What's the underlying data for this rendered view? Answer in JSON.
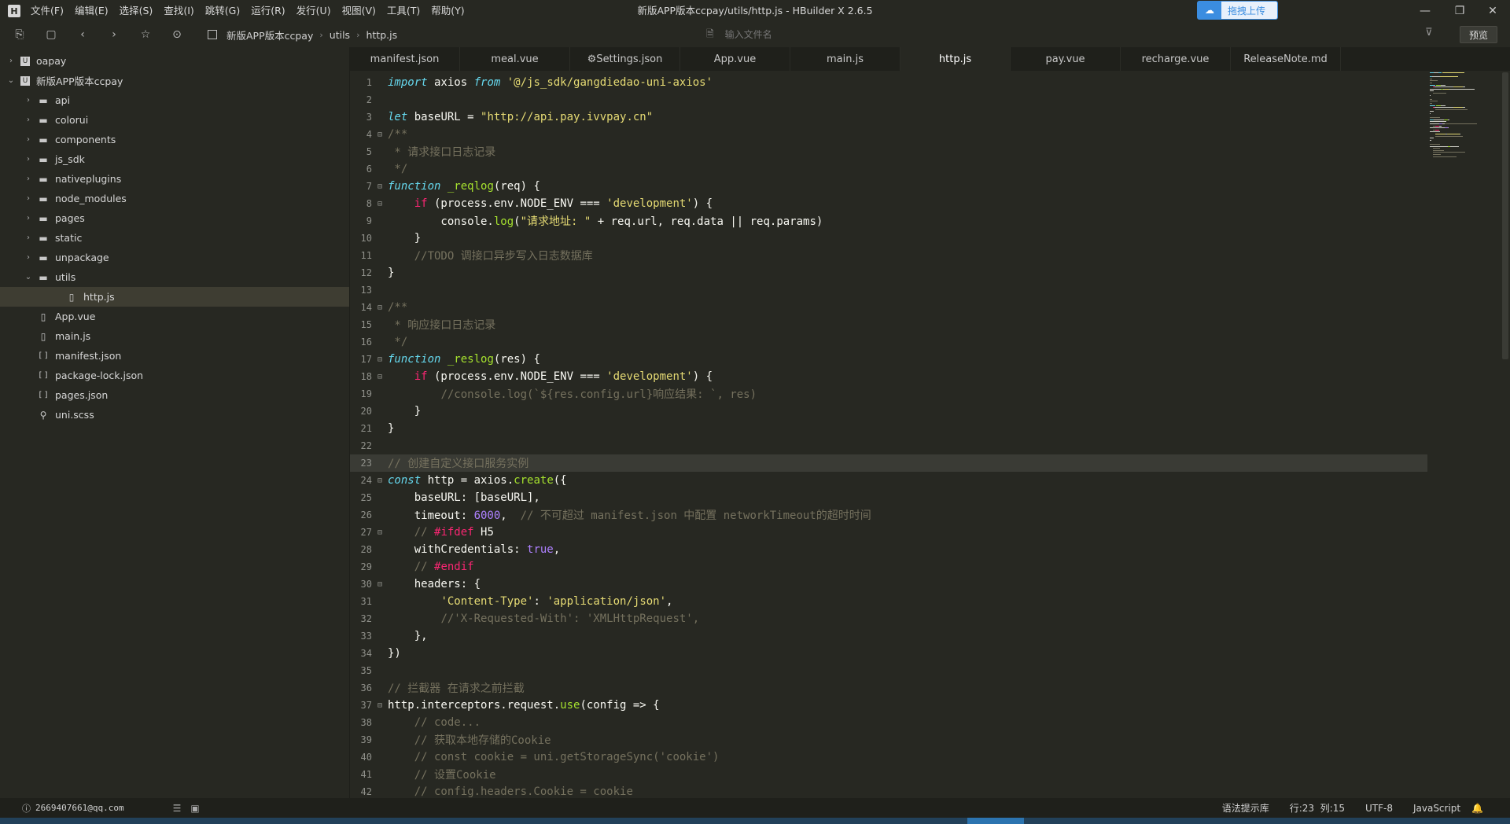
{
  "window": {
    "title": "新版APP版本ccpay/utils/http.js - HBuilder X 2.6.5",
    "upload_label": "拖拽上传"
  },
  "menu": [
    "文件(F)",
    "编辑(E)",
    "选择(S)",
    "查找(I)",
    "跳转(G)",
    "运行(R)",
    "发行(U)",
    "视图(V)",
    "工具(T)",
    "帮助(Y)"
  ],
  "toolbar": {
    "breadcrumb": [
      "新版APP版本ccpay",
      "utils",
      "http.js"
    ],
    "file_search_placeholder": "输入文件名",
    "preview_label": "预览"
  },
  "sidebar": {
    "items": [
      {
        "label": "oapay",
        "depth": 0,
        "kind": "project",
        "expanded": false
      },
      {
        "label": "新版APP版本ccpay",
        "depth": 0,
        "kind": "project",
        "expanded": true
      },
      {
        "label": "api",
        "depth": 1,
        "kind": "folder",
        "expanded": false
      },
      {
        "label": "colorui",
        "depth": 1,
        "kind": "folder",
        "expanded": false
      },
      {
        "label": "components",
        "depth": 1,
        "kind": "folder",
        "expanded": false
      },
      {
        "label": "js_sdk",
        "depth": 1,
        "kind": "folder",
        "expanded": false
      },
      {
        "label": "nativeplugins",
        "depth": 1,
        "kind": "folder",
        "expanded": false
      },
      {
        "label": "node_modules",
        "depth": 1,
        "kind": "folder",
        "expanded": false
      },
      {
        "label": "pages",
        "depth": 1,
        "kind": "folder",
        "expanded": false
      },
      {
        "label": "static",
        "depth": 1,
        "kind": "folder",
        "expanded": false
      },
      {
        "label": "unpackage",
        "depth": 1,
        "kind": "folder",
        "expanded": false
      },
      {
        "label": "utils",
        "depth": 1,
        "kind": "folder",
        "expanded": true
      },
      {
        "label": "http.js",
        "depth": 2,
        "kind": "file",
        "selected": true
      },
      {
        "label": "App.vue",
        "depth": 1,
        "kind": "vue"
      },
      {
        "label": "main.js",
        "depth": 1,
        "kind": "file"
      },
      {
        "label": "manifest.json",
        "depth": 1,
        "kind": "json"
      },
      {
        "label": "package-lock.json",
        "depth": 1,
        "kind": "json"
      },
      {
        "label": "pages.json",
        "depth": 1,
        "kind": "json"
      },
      {
        "label": "uni.scss",
        "depth": 1,
        "kind": "scss"
      }
    ]
  },
  "tabs": [
    {
      "label": "manifest.json"
    },
    {
      "label": "meal.vue"
    },
    {
      "label": "⚙Settings.json"
    },
    {
      "label": "App.vue"
    },
    {
      "label": "main.js"
    },
    {
      "label": "http.js",
      "active": true
    },
    {
      "label": "pay.vue"
    },
    {
      "label": "recharge.vue"
    },
    {
      "label": "ReleaseNote.md"
    }
  ],
  "code_lines": [
    {
      "n": "1",
      "fold": "",
      "tokens": [
        [
          "kw",
          "import"
        ],
        [
          "t",
          " axios "
        ],
        [
          "kw",
          "from"
        ],
        [
          "t",
          " "
        ],
        [
          "str",
          "'@/js_sdk/gangdiedao-uni-axios'"
        ]
      ]
    },
    {
      "n": "2",
      "fold": "",
      "tokens": []
    },
    {
      "n": "3",
      "fold": "",
      "tokens": [
        [
          "kw",
          "let"
        ],
        [
          "t",
          " baseURL = "
        ],
        [
          "str",
          "\"http://api.pay.ivvpay.cn\""
        ]
      ]
    },
    {
      "n": "4",
      "fold": "⊟",
      "tokens": [
        [
          "cmt",
          "/**"
        ]
      ]
    },
    {
      "n": "5",
      "fold": "",
      "tokens": [
        [
          "cmt",
          " * 请求接口日志记录"
        ]
      ]
    },
    {
      "n": "6",
      "fold": "",
      "tokens": [
        [
          "cmt",
          " */"
        ]
      ]
    },
    {
      "n": "7",
      "fold": "⊟",
      "tokens": [
        [
          "kw",
          "function"
        ],
        [
          "t",
          " "
        ],
        [
          "fn",
          "_reqlog"
        ],
        [
          "t",
          "(req) {"
        ]
      ]
    },
    {
      "n": "8",
      "fold": "⊟",
      "tokens": [
        [
          "t",
          "    "
        ],
        [
          "kw2",
          "if"
        ],
        [
          "t",
          " (process.env.NODE_ENV === "
        ],
        [
          "str",
          "'development'"
        ],
        [
          "t",
          ") {"
        ]
      ]
    },
    {
      "n": "9",
      "fold": "",
      "tokens": [
        [
          "t",
          "        console."
        ],
        [
          "fn",
          "log"
        ],
        [
          "t",
          "("
        ],
        [
          "str",
          "\"请求地址: \""
        ],
        [
          "t",
          " + req.url, req.data || req.params)"
        ]
      ]
    },
    {
      "n": "10",
      "fold": "",
      "tokens": [
        [
          "t",
          "    }"
        ]
      ]
    },
    {
      "n": "11",
      "fold": "",
      "tokens": [
        [
          "t",
          "    "
        ],
        [
          "cmt",
          "//TODO 调接口异步写入日志数据库"
        ]
      ]
    },
    {
      "n": "12",
      "fold": "",
      "tokens": [
        [
          "t",
          "}"
        ]
      ]
    },
    {
      "n": "13",
      "fold": "",
      "tokens": []
    },
    {
      "n": "14",
      "fold": "⊟",
      "tokens": [
        [
          "cmt",
          "/**"
        ]
      ]
    },
    {
      "n": "15",
      "fold": "",
      "tokens": [
        [
          "cmt",
          " * 响应接口日志记录"
        ]
      ]
    },
    {
      "n": "16",
      "fold": "",
      "tokens": [
        [
          "cmt",
          " */"
        ]
      ]
    },
    {
      "n": "17",
      "fold": "⊟",
      "tokens": [
        [
          "kw",
          "function"
        ],
        [
          "t",
          " "
        ],
        [
          "fn",
          "_reslog"
        ],
        [
          "t",
          "(res) {"
        ]
      ]
    },
    {
      "n": "18",
      "fold": "⊟",
      "tokens": [
        [
          "t",
          "    "
        ],
        [
          "kw2",
          "if"
        ],
        [
          "t",
          " (process.env.NODE_ENV === "
        ],
        [
          "str",
          "'development'"
        ],
        [
          "t",
          ") {"
        ]
      ]
    },
    {
      "n": "19",
      "fold": "",
      "tokens": [
        [
          "t",
          "        "
        ],
        [
          "cmt",
          "//console.log(`${res.config.url}响应结果: `, res)"
        ]
      ]
    },
    {
      "n": "20",
      "fold": "",
      "tokens": [
        [
          "t",
          "    }"
        ]
      ]
    },
    {
      "n": "21",
      "fold": "",
      "tokens": [
        [
          "t",
          "}"
        ]
      ]
    },
    {
      "n": "22",
      "fold": "",
      "tokens": []
    },
    {
      "n": "23",
      "fold": "",
      "cur": true,
      "tokens": [
        [
          "cmt",
          "// 创建自定义接口服务实例"
        ]
      ]
    },
    {
      "n": "24",
      "fold": "⊟",
      "tokens": [
        [
          "kw",
          "const"
        ],
        [
          "t",
          " http = axios."
        ],
        [
          "fn",
          "create"
        ],
        [
          "t",
          "({"
        ]
      ]
    },
    {
      "n": "25",
      "fold": "",
      "tokens": [
        [
          "t",
          "    baseURL: [baseURL],"
        ]
      ]
    },
    {
      "n": "26",
      "fold": "",
      "tokens": [
        [
          "t",
          "    timeout: "
        ],
        [
          "num",
          "6000"
        ],
        [
          "t",
          ",  "
        ],
        [
          "cmt",
          "// 不可超过 manifest.json 中配置 networkTimeout的超时时间"
        ]
      ]
    },
    {
      "n": "27",
      "fold": "⊟",
      "tokens": [
        [
          "t",
          "    "
        ],
        [
          "cmt",
          "// "
        ],
        [
          "pp",
          "#ifdef"
        ],
        [
          "t",
          " H5"
        ]
      ]
    },
    {
      "n": "28",
      "fold": "",
      "tokens": [
        [
          "t",
          "    withCredentials: "
        ],
        [
          "num",
          "true"
        ],
        [
          "t",
          ","
        ]
      ]
    },
    {
      "n": "29",
      "fold": "",
      "tokens": [
        [
          "t",
          "    "
        ],
        [
          "cmt",
          "// "
        ],
        [
          "pp",
          "#endif"
        ]
      ]
    },
    {
      "n": "30",
      "fold": "⊟",
      "tokens": [
        [
          "t",
          "    headers: {"
        ]
      ]
    },
    {
      "n": "31",
      "fold": "",
      "tokens": [
        [
          "t",
          "        "
        ],
        [
          "str",
          "'Content-Type'"
        ],
        [
          "t",
          ": "
        ],
        [
          "str",
          "'application/json'"
        ],
        [
          "t",
          ","
        ]
      ]
    },
    {
      "n": "32",
      "fold": "",
      "tokens": [
        [
          "t",
          "        "
        ],
        [
          "cmt",
          "//'X-Requested-With': 'XMLHttpRequest',"
        ]
      ]
    },
    {
      "n": "33",
      "fold": "",
      "tokens": [
        [
          "t",
          "    },"
        ]
      ]
    },
    {
      "n": "34",
      "fold": "",
      "tokens": [
        [
          "t",
          "})"
        ]
      ]
    },
    {
      "n": "35",
      "fold": "",
      "tokens": []
    },
    {
      "n": "36",
      "fold": "",
      "tokens": [
        [
          "cmt",
          "// 拦截器 在请求之前拦截"
        ]
      ]
    },
    {
      "n": "37",
      "fold": "⊟",
      "tokens": [
        [
          "t",
          "http.interceptors.request."
        ],
        [
          "fn",
          "use"
        ],
        [
          "t",
          "(config => {"
        ]
      ]
    },
    {
      "n": "38",
      "fold": "",
      "tokens": [
        [
          "t",
          "    "
        ],
        [
          "cmt",
          "// code..."
        ]
      ]
    },
    {
      "n": "39",
      "fold": "",
      "tokens": [
        [
          "t",
          "    "
        ],
        [
          "cmt",
          "// 获取本地存储的Cookie"
        ]
      ]
    },
    {
      "n": "40",
      "fold": "",
      "tokens": [
        [
          "t",
          "    "
        ],
        [
          "cmt",
          "// const cookie = uni.getStorageSync('cookie')"
        ]
      ]
    },
    {
      "n": "41",
      "fold": "",
      "tokens": [
        [
          "t",
          "    "
        ],
        [
          "cmt",
          "// 设置Cookie"
        ]
      ]
    },
    {
      "n": "42",
      "fold": "",
      "tokens": [
        [
          "t",
          "    "
        ],
        [
          "cmt",
          "// config.headers.Cookie = cookie"
        ]
      ]
    }
  ],
  "statusbar": {
    "account": "2669407661@qq.com",
    "syntax_hint": "语法提示库",
    "position": "行:23  列:15",
    "encoding": "UTF-8",
    "language": "JavaScript"
  }
}
